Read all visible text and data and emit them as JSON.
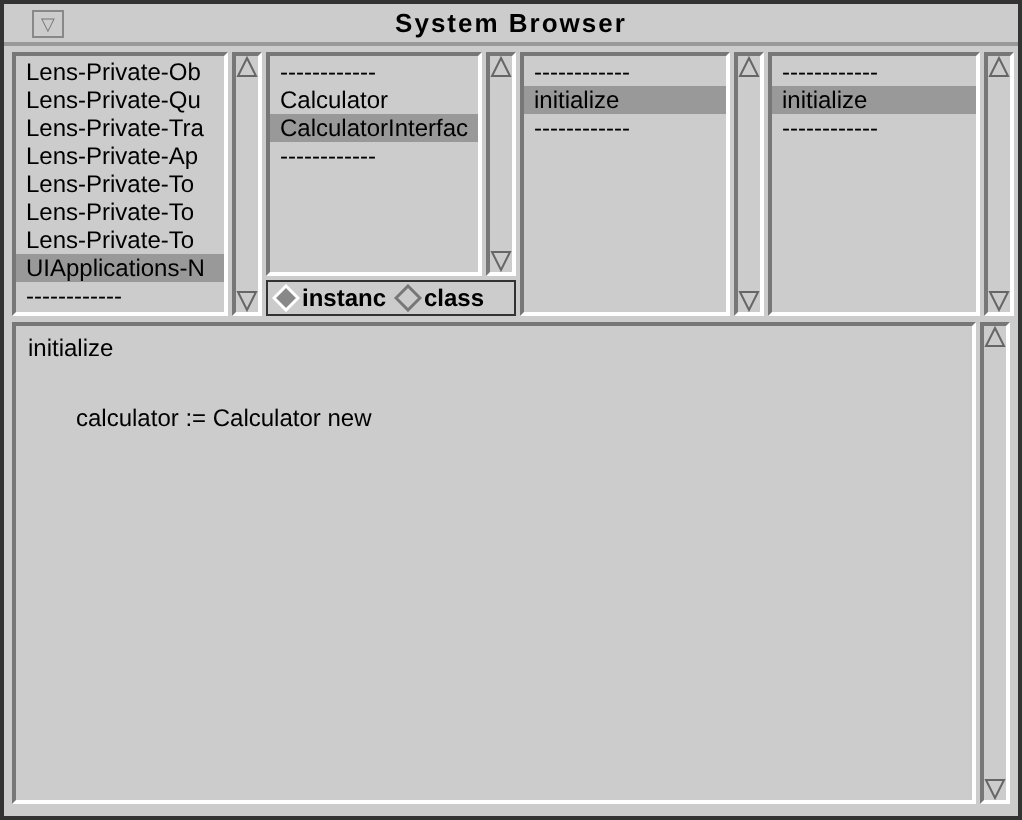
{
  "window": {
    "title": "System Browser",
    "menu_button": "▽"
  },
  "panes": [
    {
      "items": [
        {
          "text": "Lens-Private-Ob",
          "selected": false
        },
        {
          "text": "Lens-Private-Qu",
          "selected": false
        },
        {
          "text": "Lens-Private-Tra",
          "selected": false
        },
        {
          "text": "Lens-Private-Ap",
          "selected": false
        },
        {
          "text": "Lens-Private-To",
          "selected": false
        },
        {
          "text": "Lens-Private-To",
          "selected": false
        },
        {
          "text": "Lens-Private-To",
          "selected": false
        },
        {
          "text": "UIApplications-N",
          "selected": true
        },
        {
          "text": "------------",
          "selected": false
        }
      ]
    },
    {
      "items": [
        {
          "text": "------------",
          "selected": false
        },
        {
          "text": "Calculator",
          "selected": false
        },
        {
          "text": "CalculatorInterfac",
          "selected": true
        },
        {
          "text": "------------",
          "selected": false
        }
      ],
      "radios": [
        {
          "label": "instanc",
          "selected": true
        },
        {
          "label": "class",
          "selected": false
        }
      ]
    },
    {
      "items": [
        {
          "text": "------------",
          "selected": false
        },
        {
          "text": "initialize",
          "selected": true
        },
        {
          "text": "------------",
          "selected": false
        }
      ]
    },
    {
      "items": [
        {
          "text": "------------",
          "selected": false
        },
        {
          "text": "initialize",
          "selected": true
        },
        {
          "text": "------------",
          "selected": false
        }
      ]
    }
  ],
  "code": {
    "lines": [
      {
        "text": "initialize",
        "indent": false
      },
      {
        "text": "calculator := Calculator new",
        "indent": true
      }
    ]
  }
}
